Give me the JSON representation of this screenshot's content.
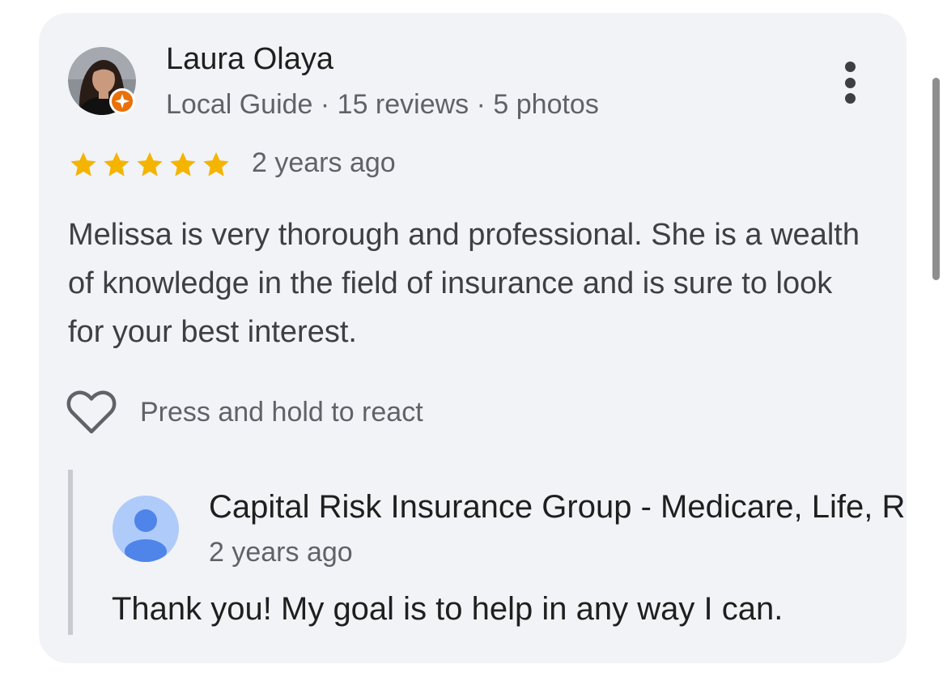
{
  "review": {
    "author": {
      "name": "Laura Olaya",
      "badge_icon": "local-guide-star-icon",
      "meta": "Local Guide · 15 reviews · 5 photos"
    },
    "menu_icon": "more-vert-icon",
    "rating": {
      "stars": 5,
      "max": 5,
      "color": "#f4b400"
    },
    "time": "2 years ago",
    "text": "Melissa is very thorough and professional. She is a wealth of knowledge in the field of insurance and is sure to look for your best interest.",
    "react": {
      "icon": "heart-outline-icon",
      "label": "Press and hold to react"
    }
  },
  "reply": {
    "owner_name": "Capital Risk Insurance Group - Medicare, Life, R",
    "owner_icon": "person-placeholder-icon",
    "time": "2 years ago",
    "text": "Thank you! My goal is to help in any way I can."
  },
  "colors": {
    "card_background": "#f2f3f7",
    "badge_orange": "#e8710a",
    "owner_avatar_bg": "#aecbfa",
    "owner_avatar_fg": "#4f84e8"
  }
}
